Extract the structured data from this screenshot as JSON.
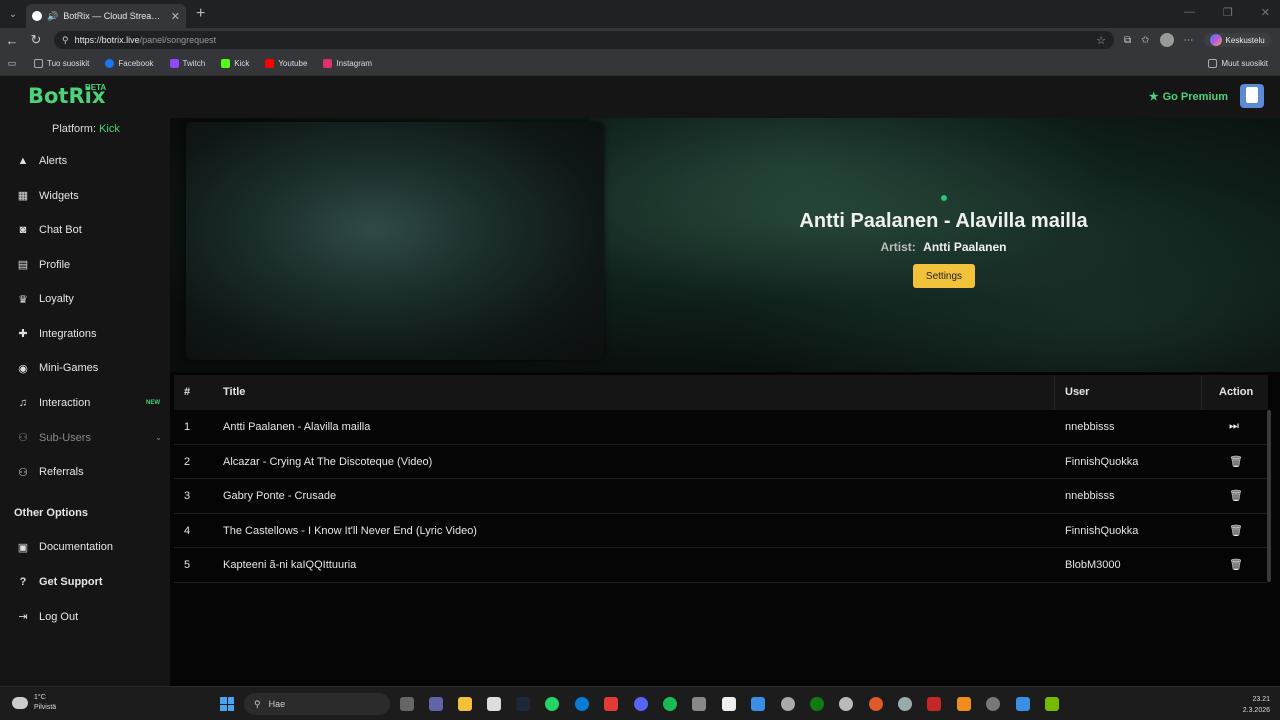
{
  "browser": {
    "tab_title": "BotRix — Cloud Streaming Bo",
    "url_host": "https://botrix.live",
    "url_path": "/panel/songrequest",
    "copilot_label": "Keskustelu",
    "bookmarks": [
      {
        "label": "Tuo suosikit",
        "color": "#aaaaaa"
      },
      {
        "label": "Facebook",
        "color": "#1877f2"
      },
      {
        "label": "Twitch",
        "color": "#9146ff"
      },
      {
        "label": "Kick",
        "color": "#53fc18"
      },
      {
        "label": "Youtube",
        "color": "#ff0000"
      },
      {
        "label": "Instagram",
        "color": "#e1306c"
      }
    ],
    "other_bookmarks": "Muut suosikit"
  },
  "app": {
    "logo": "BotRix",
    "beta": "BETA",
    "premium": "Go Premium",
    "accent": "#4bd27a"
  },
  "sidebar": {
    "platform_label": "Platform:",
    "platform_value": "Kick",
    "items": [
      {
        "label": "Alerts",
        "icon": "warning-icon"
      },
      {
        "label": "Widgets",
        "icon": "grid-icon"
      },
      {
        "label": "Chat Bot",
        "icon": "robot-icon"
      },
      {
        "label": "Profile",
        "icon": "id-card-icon"
      },
      {
        "label": "Loyalty",
        "icon": "trophy-icon"
      },
      {
        "label": "Integrations",
        "icon": "puzzle-icon"
      },
      {
        "label": "Mini-Games",
        "icon": "gamepad-icon"
      },
      {
        "label": "Interaction",
        "icon": "music-icon",
        "badge": "NEW"
      },
      {
        "label": "Sub-Users",
        "icon": "users-icon"
      },
      {
        "label": "Referrals",
        "icon": "users-icon"
      }
    ],
    "other_title": "Other Options",
    "other_items": [
      {
        "label": "Documentation",
        "icon": "book-icon"
      },
      {
        "label": "Get Support",
        "icon": "question-icon"
      },
      {
        "label": "Log Out",
        "icon": "logout-icon"
      }
    ]
  },
  "now_playing": {
    "title": "Antti Paalanen - Alavilla mailla",
    "artist_label": "Artist:",
    "artist": "Antti Paalanen",
    "settings_label": "Settings"
  },
  "queue": {
    "columns": [
      "#",
      "Title",
      "User",
      "Action"
    ],
    "rows": [
      {
        "n": "1",
        "title": "Antti Paalanen - Alavilla mailla",
        "user": "nnebbisss",
        "action": "skip-icon"
      },
      {
        "n": "2",
        "title": "Alcazar - Crying At The Discoteque (Video)",
        "user": "FinnishQuokka",
        "action": "trash-icon"
      },
      {
        "n": "3",
        "title": "Gabry Ponte - Crusade",
        "user": "nnebbisss",
        "action": "trash-icon"
      },
      {
        "n": "4",
        "title": "The Castellows - I Know It'll Never End (Lyric Video)",
        "user": "FinnishQuokka",
        "action": "trash-icon"
      },
      {
        "n": "5",
        "title": "Kapteeni ã-ni kaIQQIttuuria",
        "user": "BlobM3000",
        "action": "trash-icon"
      }
    ]
  },
  "taskbar": {
    "weather_temp": "1°C",
    "weather_desc": "Pilvistä",
    "search_placeholder": "Hae",
    "time": "23.21",
    "date": "2.3.2026"
  }
}
